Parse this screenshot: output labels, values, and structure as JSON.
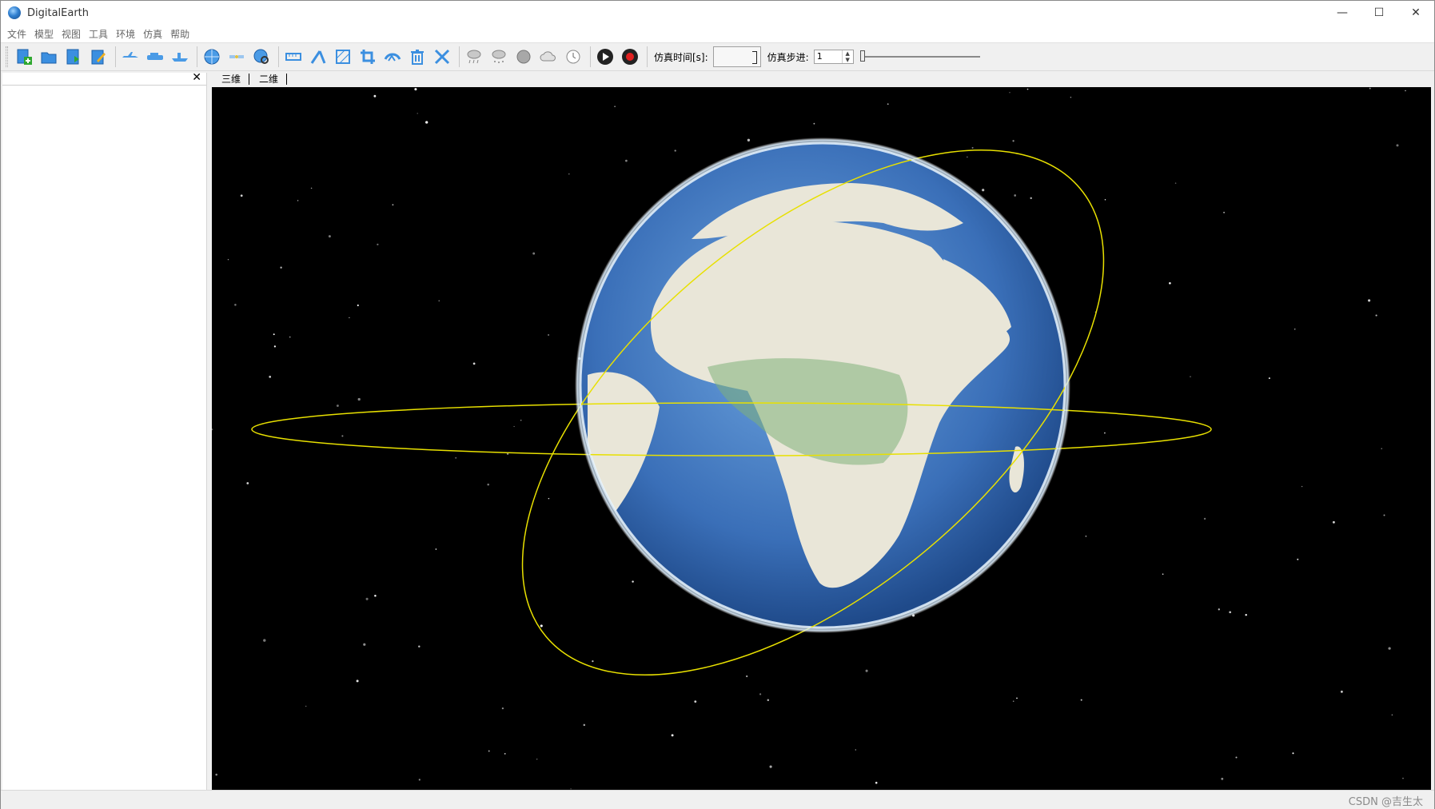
{
  "window": {
    "title": "DigitalEarth",
    "controls": [
      "—",
      "☐",
      "✕"
    ]
  },
  "menu": [
    "文件",
    "模型",
    "视图",
    "工具",
    "环境",
    "仿真",
    "帮助"
  ],
  "toolbar": {
    "icons": [
      "new-file-icon",
      "open-folder-icon",
      "export-icon",
      "edit-document-icon",
      "aircraft-icon",
      "vehicle-icon",
      "ship-icon",
      "globe-icon",
      "satellite-icon",
      "globe-search-icon",
      "ruler-icon",
      "angle-measure-icon",
      "area-measure-icon",
      "crop-icon",
      "visibility-icon",
      "delete-icon",
      "settings-tool-icon",
      "rain-icon",
      "snow-icon",
      "fog-icon",
      "cloud-icon",
      "clock-icon",
      "play-icon",
      "stop-icon"
    ],
    "sim_time_label": "仿真时间[s]:",
    "sim_time_value": "",
    "sim_step_label": "仿真步进:",
    "sim_step_value": "1",
    "step_slider_position": 0
  },
  "left_panel": {
    "close_label": "✕"
  },
  "tabs": [
    "三维",
    "二维"
  ],
  "viewer": {
    "background": "#000000",
    "orbit_color": "#e8e000",
    "ocean_color": "#3f78c0",
    "land_color": "#e9e6d8"
  },
  "status": {
    "watermark": "CSDN @吉生太"
  }
}
